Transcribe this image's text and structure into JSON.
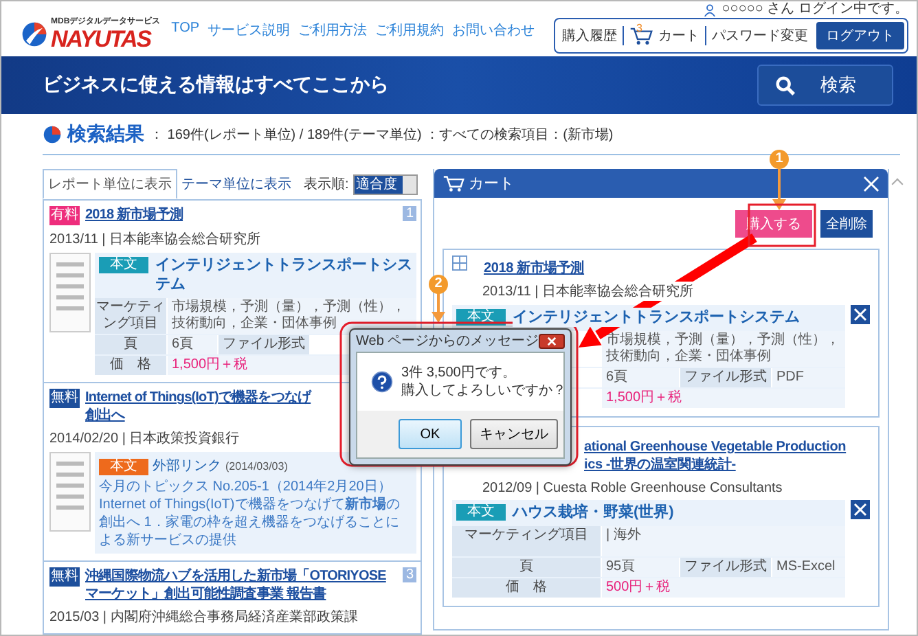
{
  "header": {
    "logo_tagline": "MDBデジタルデータサービス",
    "logo": "NAYUTAS",
    "nav": [
      "TOP",
      "サービス説明",
      "ご利用方法",
      "ご利用規約",
      "お問い合わせ"
    ],
    "user_status": "○○○○○ さん ログイン中です。",
    "account_menu": {
      "history": "購入履歴",
      "cart_count": "3",
      "cart": "カート",
      "password": "パスワード変更",
      "logout": "ログアウト"
    }
  },
  "banner": {
    "tagline": "ビジネスに使える情報はすべてここから",
    "search_button": "検索"
  },
  "results": {
    "title": "検索結果",
    "summary": "： 169件(レポート単位) / 189件(テーマ単位) ：すべての検索項目：(新市場)"
  },
  "view_tabs": [
    {
      "label": "レポート単位に表示",
      "selected": true
    },
    {
      "label": "テーマ単位に表示",
      "selected": false
    }
  ],
  "sort": {
    "label": "表示順:",
    "value": "適合度"
  },
  "results_list": [
    {
      "badge": "有料",
      "paid": true,
      "title_lines": [
        "2018 新市場予測"
      ],
      "index": "1",
      "meta": "2013/11 | 日本能率協会総合研究所",
      "detail": {
        "kind": "table",
        "tag": "本文",
        "theme": "インテリジェントトランスポートシステム",
        "marketing_label": "マーケティング項目",
        "marketing": "市場規模，予測（量），予測（性），技術動向，企業・団体事例",
        "pages_label": "頁",
        "pages": "6頁",
        "format_label": "ファイル形式",
        "price_label": "価　格",
        "price": "1,500円＋税"
      }
    },
    {
      "badge": "無料",
      "paid": false,
      "title_lines": [
        "Internet of Things(IoT)で機器をつなげ",
        "創出へ"
      ],
      "meta": "2014/02/20 | 日本政策投資銀行",
      "detail": {
        "kind": "snippet",
        "tag": "本文",
        "link": "外部リンク",
        "link_date": "(2014/03/03)",
        "text": "今月のトピックス No.205-1（2014年2月20日） Internet of Things(IoT)で機器をつなげて**新市場**の創出へ 1．家電の枠を超え機器をつなげることによる新サービスの提供"
      }
    },
    {
      "badge": "無料",
      "paid": false,
      "title_lines": [
        "沖縄国際物流ハブを活用した新市場「OTORIYOSE",
        "マーケット」創出可能性調査事業 報告書"
      ],
      "index": "3",
      "meta": "2015/03 | 内閣府沖縄総合事務局経済産業部政策課"
    }
  ],
  "cart": {
    "title": "カート",
    "buy_button": "購入する",
    "clear_button": "全削除",
    "items": [
      {
        "title_lines": [
          "2018 新市場予測"
        ],
        "meta": "2013/11 | 日本能率協会総合研究所",
        "detail": {
          "tag": "本文",
          "theme": "インテリジェントトランスポートシステム",
          "marketing": "市場規模，予測（量），予測（性），技術動向，企業・団体事例",
          "pages": "6頁",
          "format_label": "ファイル形式",
          "format": "PDF",
          "price": "1,500円＋税"
        }
      },
      {
        "title_lines": [
          "ational Greenhouse Vegetable Production",
          "ics -世界の温室関連統計-"
        ],
        "meta": "2012/09 | Cuesta Roble Greenhouse Consultants",
        "detail": {
          "tag": "本文",
          "theme": "ハウス栽培・野菜(世界)",
          "marketing_label": "マーケティング項目",
          "marketing": "| 海外",
          "pages_label": "頁",
          "pages": "95頁",
          "format_label": "ファイル形式",
          "format": "MS-Excel",
          "price_label": "価　格",
          "price": "500円＋税"
        }
      }
    ]
  },
  "dialog": {
    "title": "Web ページからのメッセージ",
    "message_lines": [
      "3件  3,500円です。",
      "購入してよろしいですか？"
    ],
    "ok_button": "OK",
    "cancel_button": "キャンセル"
  },
  "annotations": [
    {
      "number": "1"
    },
    {
      "number": "2"
    }
  ]
}
